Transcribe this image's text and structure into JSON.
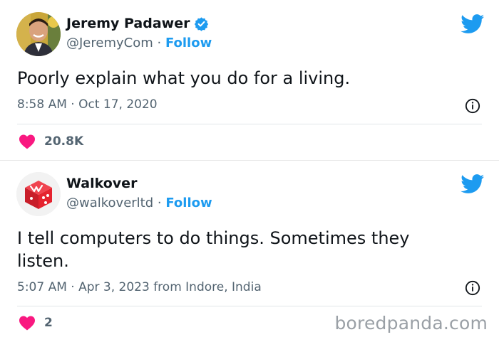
{
  "tweets": [
    {
      "name": "Jeremy Padawer",
      "handle": "@JeremyCom",
      "separator": "·",
      "follow": "Follow",
      "verified": true,
      "text_lines": [
        "Poorly explain what you do for a living."
      ],
      "meta": "8:58 AM · Oct 17, 2020",
      "likes": "20.8K",
      "avatar_icon": "profile-photo",
      "brand_icon": "twitter-bird-icon"
    },
    {
      "name": "Walkover",
      "handle": "@walkoverltd",
      "separator": "·",
      "follow": "Follow",
      "verified": false,
      "text_lines": [
        "I tell computers to do things. Sometimes they",
        "listen."
      ],
      "meta": "5:07 AM · Apr 3, 2023 from Indore, India",
      "likes": "2",
      "avatar_icon": "walkover-dice-logo",
      "brand_icon": "twitter-bird-icon"
    }
  ],
  "watermark": "boredpanda.com",
  "colors": {
    "accent": "#1d9bf0",
    "heart": "#f91880",
    "muted": "#536471",
    "logo_red": "#e5232f"
  }
}
